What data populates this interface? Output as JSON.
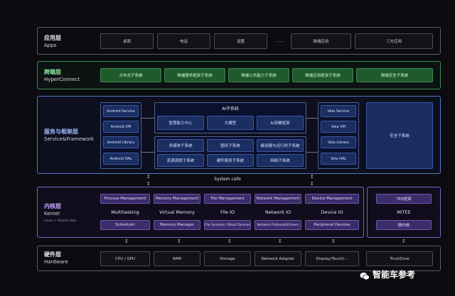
{
  "apps": {
    "title_cn": "应用层",
    "title_en": "Apps",
    "items": [
      "桌面",
      "电话",
      "设置",
      "……",
      "跨端应用",
      "三方应用"
    ]
  },
  "hyper": {
    "title_cn": "跨端层",
    "title_en": "HyperConnect",
    "items": [
      "分布式子系统",
      "跨端服务框架子系统",
      "跨端公共能力子系统",
      "跨端应用框架子系统",
      "跨端安全子系统"
    ]
  },
  "service": {
    "title_cn": "服务与框架层",
    "title_en": "Service&Framework",
    "android": [
      "Android Service",
      "Android VM",
      "Android Library",
      "Android HAL"
    ],
    "ai_title": "AI子系统",
    "ai_items": [
      "智慧能力中心",
      "大模型",
      "AI部署框架"
    ],
    "mid_items": [
      "多媒体子系统",
      "图形子系统",
      "编译器与运行时子系统",
      "资源调度子系统",
      "硬件服务子系统",
      "网络子系统"
    ],
    "vela": [
      "Vela Service",
      "Vela VM",
      "Vela Library",
      "Vela HAL"
    ],
    "security": "安全子系统"
  },
  "syscalls": "System calls",
  "kernel": {
    "title_cn": "内核层",
    "title_en": "Kernel",
    "note": "Linux + Xiaomi Vela",
    "columns": [
      {
        "top": "Process Management",
        "mid": "Multitasking",
        "bottom": "Scheduler"
      },
      {
        "top": "Memory Management",
        "mid": "Virtual Memory",
        "bottom": "Memory Manager"
      },
      {
        "top": "File Management",
        "mid": "File IO",
        "bottom": "File Systems / Block Devices"
      },
      {
        "top": "Network Management",
        "mid": "Network IO",
        "bottom": "Network Protocols/Drivers"
      },
      {
        "top": "Device Management",
        "mid": "Device IO",
        "bottom": "Peripheral Devices"
      }
    ],
    "tee": {
      "top": "TEE框架",
      "mid": "MiTEE",
      "bottom": "微内核"
    }
  },
  "hardware": {
    "title_cn": "硬件层",
    "title_en": "Hardware",
    "items": [
      "CPU / GPU",
      "RAM",
      "Storage",
      "Network Adapter",
      "Display/Touch/…",
      "TrustZone"
    ]
  },
  "watermark": "智能车参考",
  "colors": {
    "green": "#1f5a2c",
    "blue": "#1a2e62",
    "purple": "#3c2c6a",
    "bg": "#0b0b10"
  }
}
